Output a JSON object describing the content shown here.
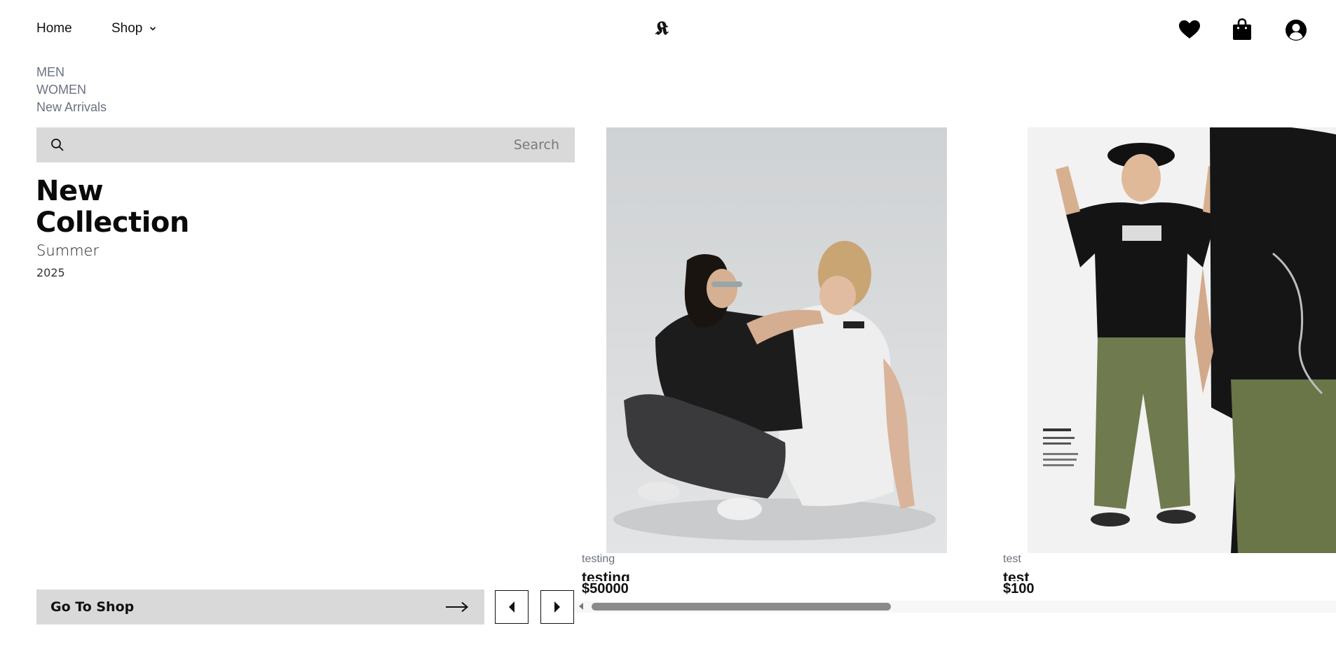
{
  "header": {
    "nav": [
      {
        "label": "Home"
      },
      {
        "label": "Shop",
        "icon": "chevron-down-icon"
      }
    ],
    "logo": "𝕶",
    "icons": [
      "heart-icon",
      "bag-icon",
      "user-icon"
    ]
  },
  "categories": [
    "MEN",
    "WOMEN",
    "New Arrivals"
  ],
  "search": {
    "placeholder": "Search",
    "value": ""
  },
  "hero": {
    "title_line1": "New",
    "title_line2": "Collection",
    "subtitle": "Summer",
    "year": "2025"
  },
  "products": [
    {
      "category": "testing",
      "name": "testing",
      "price": "$50000"
    },
    {
      "category": "test",
      "name": "test",
      "price": "$100"
    }
  ],
  "cta": {
    "label": "Go To Shop"
  },
  "carousel": {
    "scroll_position": 0.0
  },
  "colors": {
    "panel": "#d9d9d9",
    "muted": "#6b7280",
    "text": "#111111"
  }
}
